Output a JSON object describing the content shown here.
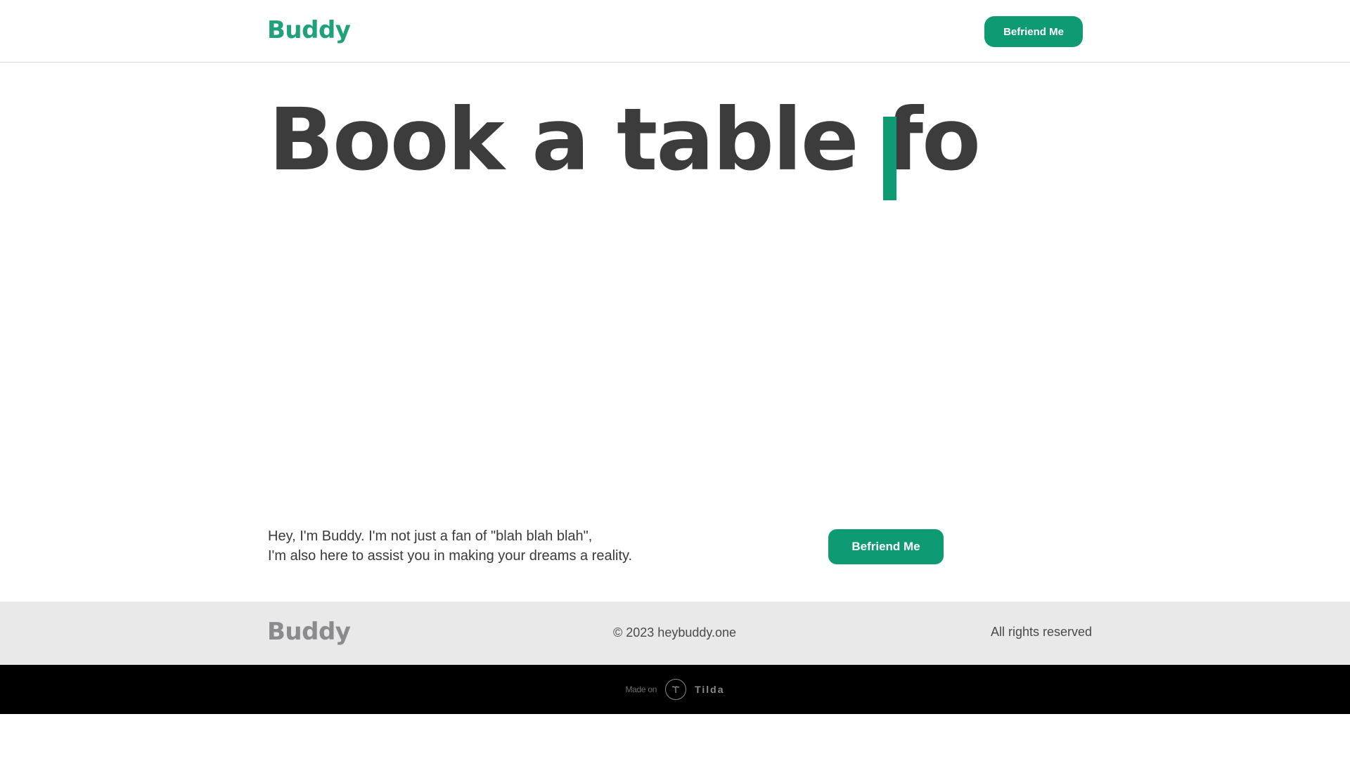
{
  "header": {
    "logo_text": "Buddy",
    "cta_label": "Befriend Me"
  },
  "hero": {
    "typed_text": "Book a table fo"
  },
  "intro": {
    "line1": "Hey, I'm Buddy. I'm not just a fan of \"blah blah blah\",",
    "line2": "I'm also here to assist you in making your dreams a reality.",
    "cta_label": "Befriend Me"
  },
  "footer": {
    "logo_text": "Buddy",
    "copyright": "© 2023 heybuddy.one",
    "rights": "All rights reserved"
  },
  "made_on": {
    "prefix": "Made on",
    "platform": "Tilda",
    "icon": "tilda-logo-icon"
  },
  "colors": {
    "brand_green": "#0e9b73",
    "logo_green": "#1fa27c",
    "heading_text": "#3c3c3c",
    "footer_bg": "#e9e9e9",
    "footer_logo": "#8a8a8f"
  }
}
